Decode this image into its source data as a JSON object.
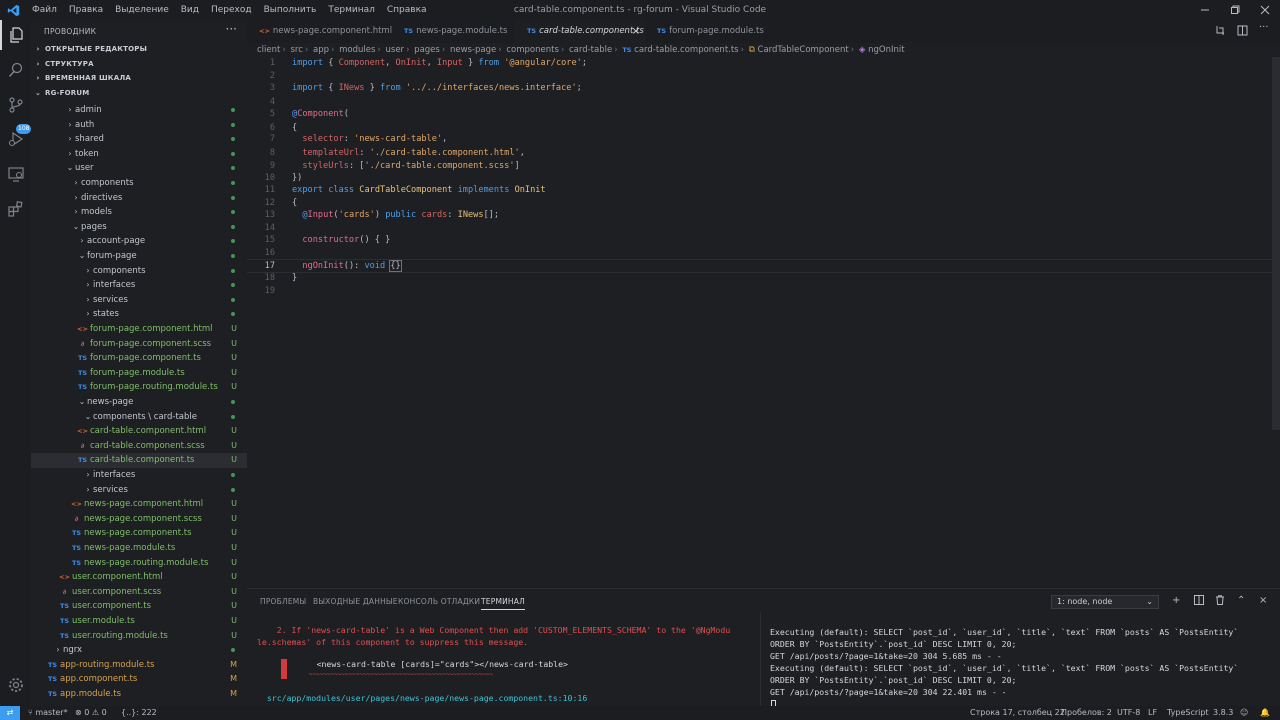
{
  "menu": [
    "Файл",
    "Правка",
    "Выделение",
    "Вид",
    "Переход",
    "Выполнить",
    "Терминал",
    "Справка"
  ],
  "window_title": "card-table.component.ts - rg-forum - Visual Studio Code",
  "activity_badge": "108",
  "sidebar": {
    "title": "ПРОВОДНИК",
    "sections": [
      "ОТКРЫТЫЕ РЕДАКТОРЫ",
      "СТРУКТУРА",
      "ВРЕМЕННАЯ ШКАЛА",
      "RG-FORUM"
    ],
    "tree": [
      {
        "label": "admin",
        "type": "folder",
        "status": "dot"
      },
      {
        "label": "auth",
        "type": "folder",
        "status": "dot"
      },
      {
        "label": "shared",
        "type": "folder",
        "status": "dot"
      },
      {
        "label": "token",
        "type": "folder",
        "status": "dot"
      },
      {
        "label": "user",
        "type": "folder-open",
        "status": "dot"
      },
      {
        "label": "components",
        "type": "folder",
        "status": "dot"
      },
      {
        "label": "directives",
        "type": "folder",
        "status": "dot"
      },
      {
        "label": "models",
        "type": "folder",
        "status": "dot"
      },
      {
        "label": "pages",
        "type": "folder-open",
        "status": "dot"
      },
      {
        "label": "account-page",
        "type": "folder",
        "status": "dot"
      },
      {
        "label": "forum-page",
        "type": "folder-open",
        "status": "dot"
      },
      {
        "label": "components",
        "type": "folder",
        "status": "dot"
      },
      {
        "label": "interfaces",
        "type": "folder",
        "status": "dot"
      },
      {
        "label": "services",
        "type": "folder",
        "status": "dot"
      },
      {
        "label": "states",
        "type": "folder",
        "status": "dot"
      },
      {
        "label": "forum-page.component.html",
        "type": "html",
        "status": "U"
      },
      {
        "label": "forum-page.component.scss",
        "type": "scss",
        "status": "U"
      },
      {
        "label": "forum-page.component.ts",
        "type": "ts",
        "status": "U"
      },
      {
        "label": "forum-page.module.ts",
        "type": "ts",
        "status": "U"
      },
      {
        "label": "forum-page.routing.module.ts",
        "type": "ts",
        "status": "U"
      },
      {
        "label": "news-page",
        "type": "folder-open",
        "status": "dot"
      },
      {
        "label": "components \\ card-table",
        "type": "folder-open",
        "status": "dot"
      },
      {
        "label": "card-table.component.html",
        "type": "html",
        "status": "U"
      },
      {
        "label": "card-table.component.scss",
        "type": "scss",
        "status": "U"
      },
      {
        "label": "card-table.component.ts",
        "type": "ts",
        "status": "U"
      },
      {
        "label": "interfaces",
        "type": "folder",
        "status": "dot"
      },
      {
        "label": "services",
        "type": "folder",
        "status": "dot"
      },
      {
        "label": "news-page.component.html",
        "type": "html",
        "status": "U"
      },
      {
        "label": "news-page.component.scss",
        "type": "scss",
        "status": "U"
      },
      {
        "label": "news-page.component.ts",
        "type": "ts",
        "status": "U"
      },
      {
        "label": "news-page.module.ts",
        "type": "ts",
        "status": "U"
      },
      {
        "label": "news-page.routing.module.ts",
        "type": "ts",
        "status": "U"
      },
      {
        "label": "user.component.html",
        "type": "html",
        "status": "U"
      },
      {
        "label": "user.component.scss",
        "type": "scss",
        "status": "U"
      },
      {
        "label": "user.component.ts",
        "type": "ts",
        "status": "U"
      },
      {
        "label": "user.module.ts",
        "type": "ts",
        "status": "U"
      },
      {
        "label": "user.routing.module.ts",
        "type": "ts",
        "status": "U"
      },
      {
        "label": "ngrx",
        "type": "folder",
        "status": "dot"
      },
      {
        "label": "app-routing.module.ts",
        "type": "ts",
        "status": "M"
      },
      {
        "label": "app.component.ts",
        "type": "ts",
        "status": "M"
      },
      {
        "label": "app.module.ts",
        "type": "ts",
        "status": "M"
      }
    ]
  },
  "tabs": [
    {
      "label": "news-page.component.html",
      "icon": "<>"
    },
    {
      "label": "news-page.module.ts",
      "icon": "TS"
    },
    {
      "label": "card-table.component.ts",
      "icon": "TS"
    },
    {
      "label": "forum-page.module.ts",
      "icon": "TS"
    }
  ],
  "breadcrumb": [
    "client",
    "src",
    "app",
    "modules",
    "user",
    "pages",
    "news-page",
    "components",
    "card-table",
    "card-table.component.ts",
    "CardTableComponent",
    "ngOnInit"
  ],
  "code_lines": [
    "1",
    "2",
    "3",
    "4",
    "5",
    "6",
    "7",
    "8",
    "9",
    "10",
    "11",
    "12",
    "13",
    "14",
    "15",
    "16",
    "17",
    "18",
    "19"
  ],
  "panel": {
    "tabs": [
      "ПРОБЛЕМЫ",
      "ВЫХОДНЫЕ ДАННЫЕ",
      "КОНСОЛЬ ОТЛАДКИ",
      "ТЕРМИНАЛ"
    ],
    "terminal_select": "1: node, node",
    "left": [
      "    2. If 'news-card-table' is a Web Component then add 'CUSTOM_ELEMENTS_SCHEMA' to the '@NgModu",
      "le.schemas' of this component to suppress this message.",
      "      <news-card-table [cards]=\"cards\"></news-card-table>",
      "      ~~~~~~~~~~~~~~~~~~~~~~~~~~~~~~~~~~~~~~~~~~~~~~~~~~~",
      "  src/app/modules/user/pages/news-page/news-page.component.ts:10:16"
    ],
    "right": [
      "Executing (default): SELECT `post_id`, `user_id`, `title`, `text` FROM `posts` AS `PostsEntity`",
      "ORDER BY `PostsEntity`.`post_id` DESC LIMIT 0, 20;",
      "GET /api/posts/?page=1&take=20 304 5.685 ms - -",
      "Executing (default): SELECT `post_id`, `user_id`, `title`, `text` FROM `posts` AS `PostsEntity`",
      "ORDER BY `PostsEntity`.`post_id` DESC LIMIT 0, 20;",
      "GET /api/posts/?page=1&take=20 304 22.401 ms - -"
    ]
  },
  "status": {
    "branch": "master*",
    "errors": "0",
    "warnings": "0",
    "selection": "{..}: 222",
    "position": "Строка 17, столбец 22",
    "spaces": "Пробелов: 2",
    "encoding": "UTF-8",
    "eol": "LF",
    "language": "TypeScript",
    "version": "3.8.3"
  }
}
